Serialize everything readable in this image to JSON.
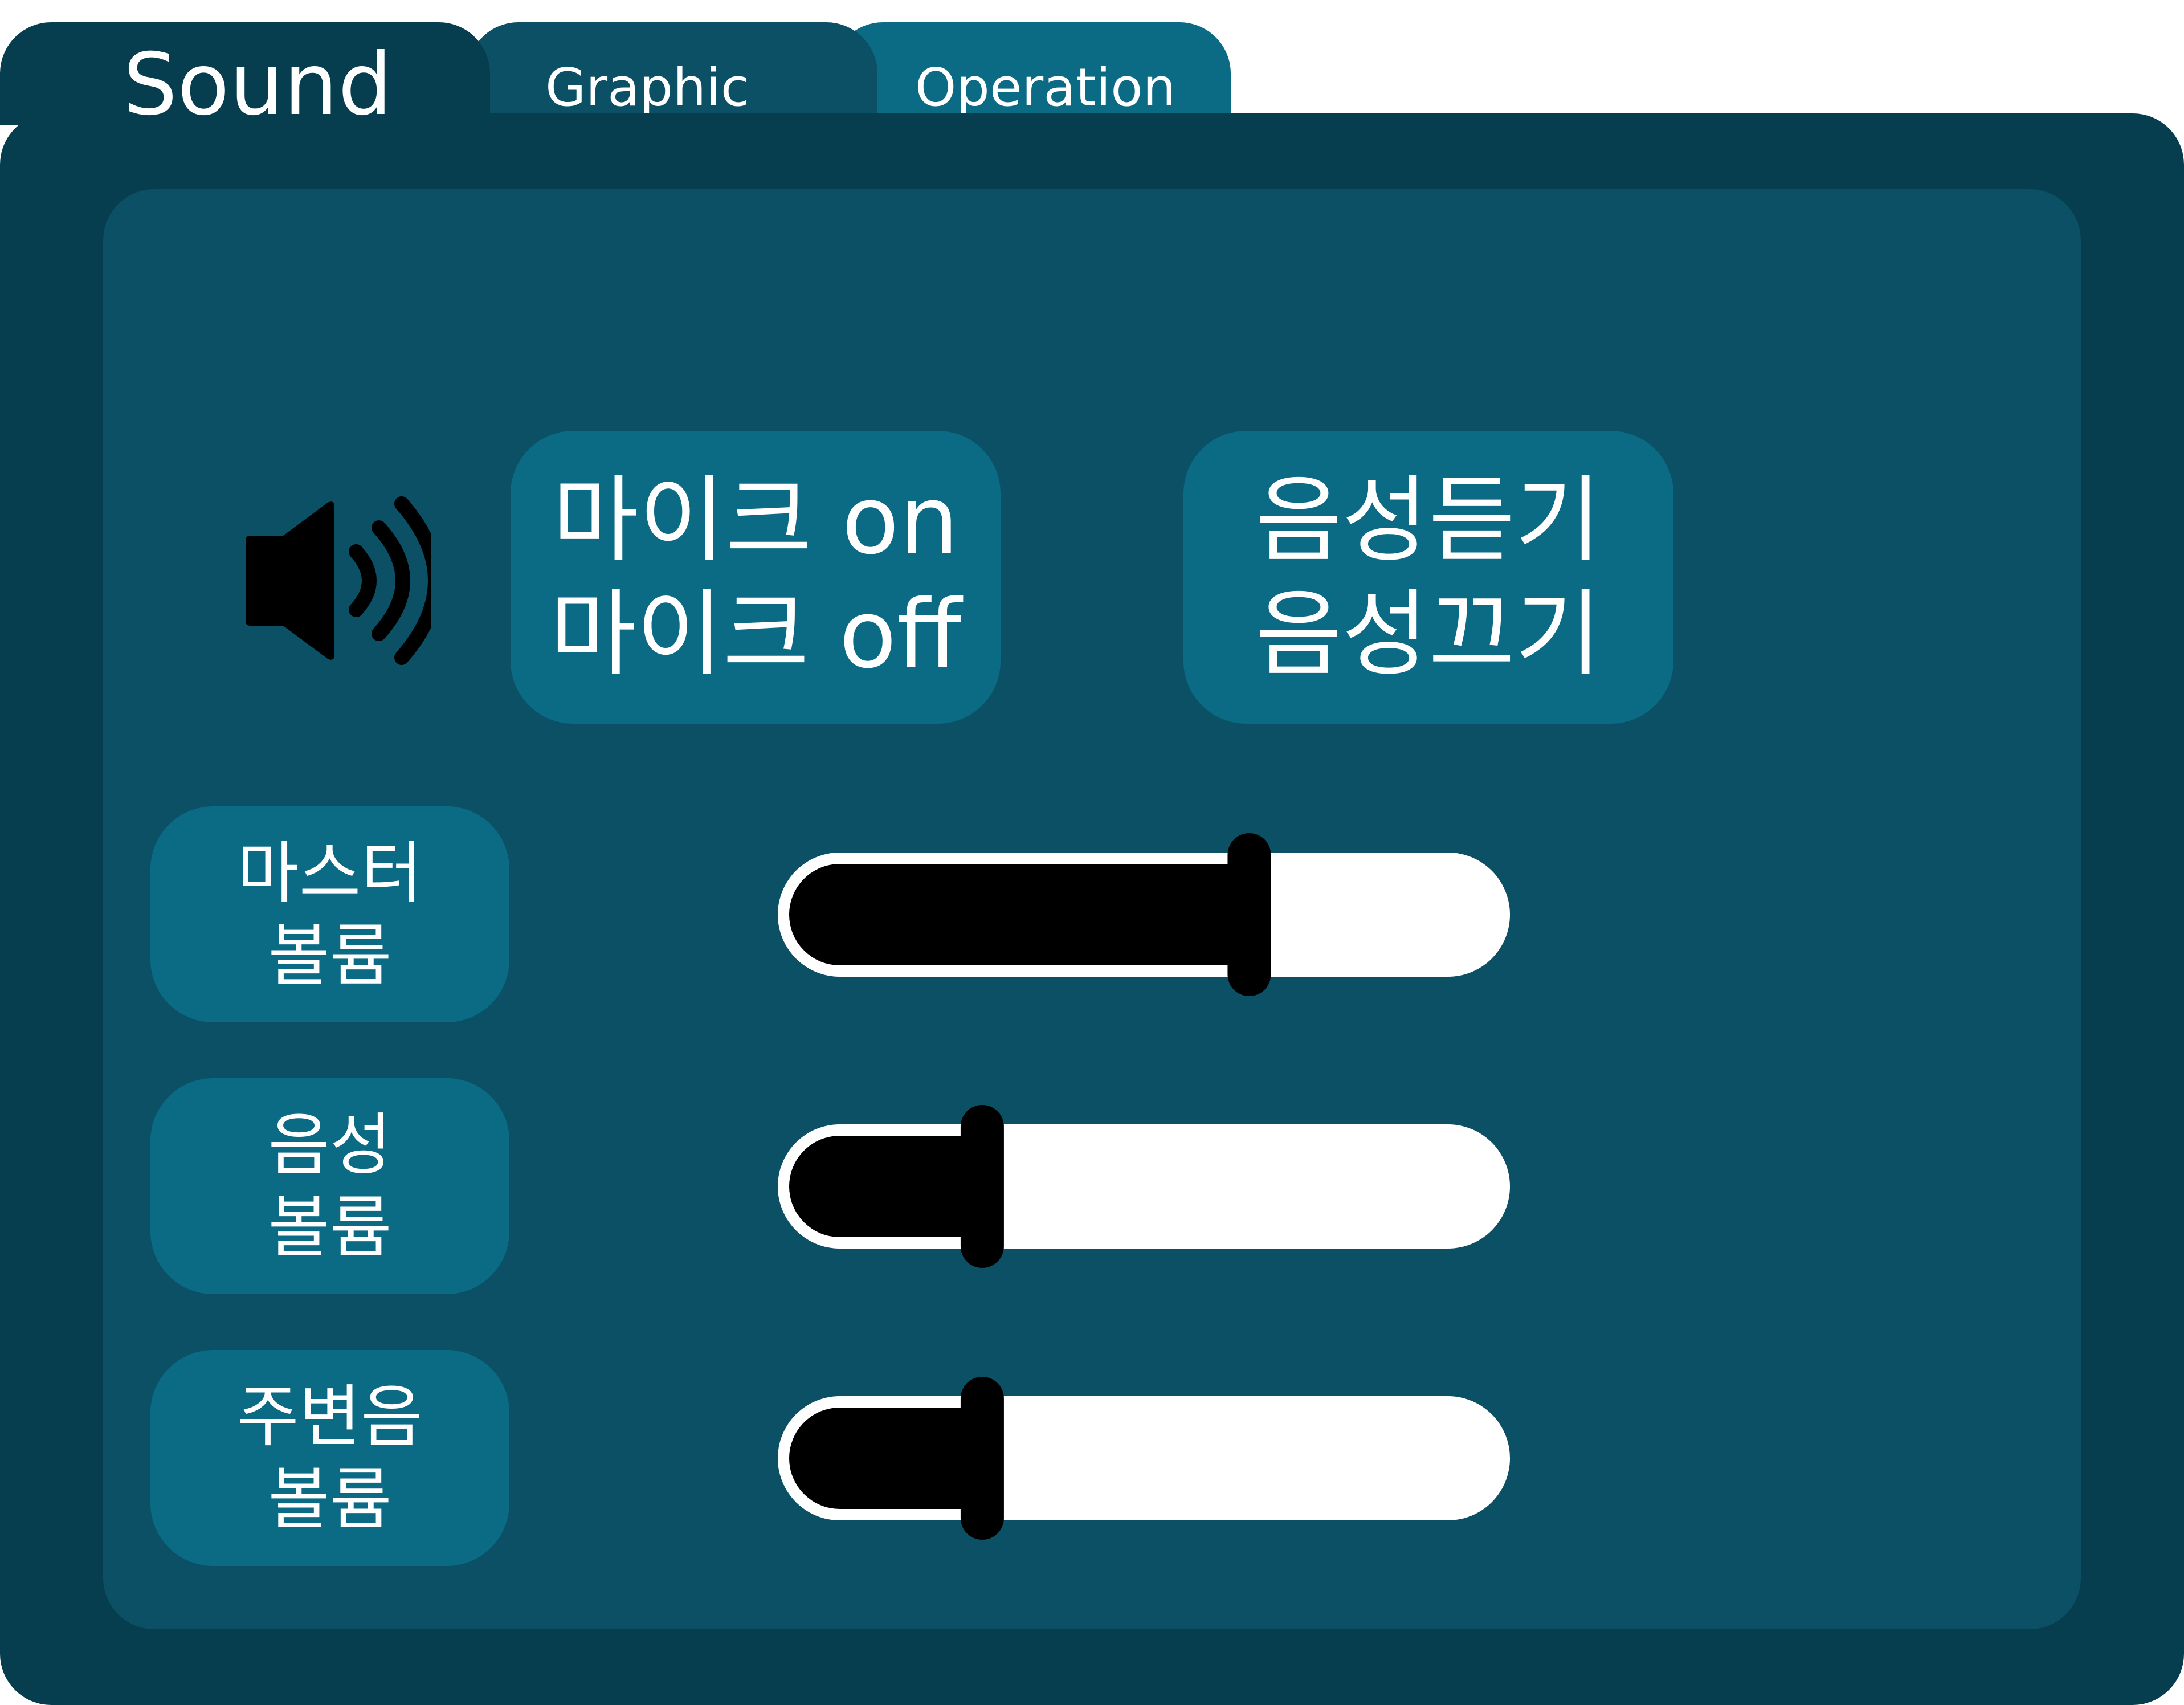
{
  "colors": {
    "panel_dark": "#063e50",
    "panel_mid": "#0b5064",
    "button_teal": "#0b6a84",
    "slider_fill": "#000000",
    "slider_track": "#ffffff",
    "text": "#ffffff"
  },
  "tabs": [
    {
      "label": "Sound",
      "active": true
    },
    {
      "label": "Graphic",
      "active": false
    },
    {
      "label": "Operation",
      "active": false
    }
  ],
  "speaker_icon": "speaker-volume-icon",
  "mic_button": {
    "line1": "마이크 on",
    "line2": "마이크 off"
  },
  "voice_button": {
    "line1": "음성듣기",
    "line2": "음성끄기"
  },
  "sliders": [
    {
      "label_line1": "마스터",
      "label_line2": "볼륨",
      "level": 0.65
    },
    {
      "label_line1": "음성",
      "label_line2": "볼륨",
      "level": 0.27
    },
    {
      "label_line1": "주변음",
      "label_line2": "볼륨",
      "level": 0.27
    }
  ]
}
